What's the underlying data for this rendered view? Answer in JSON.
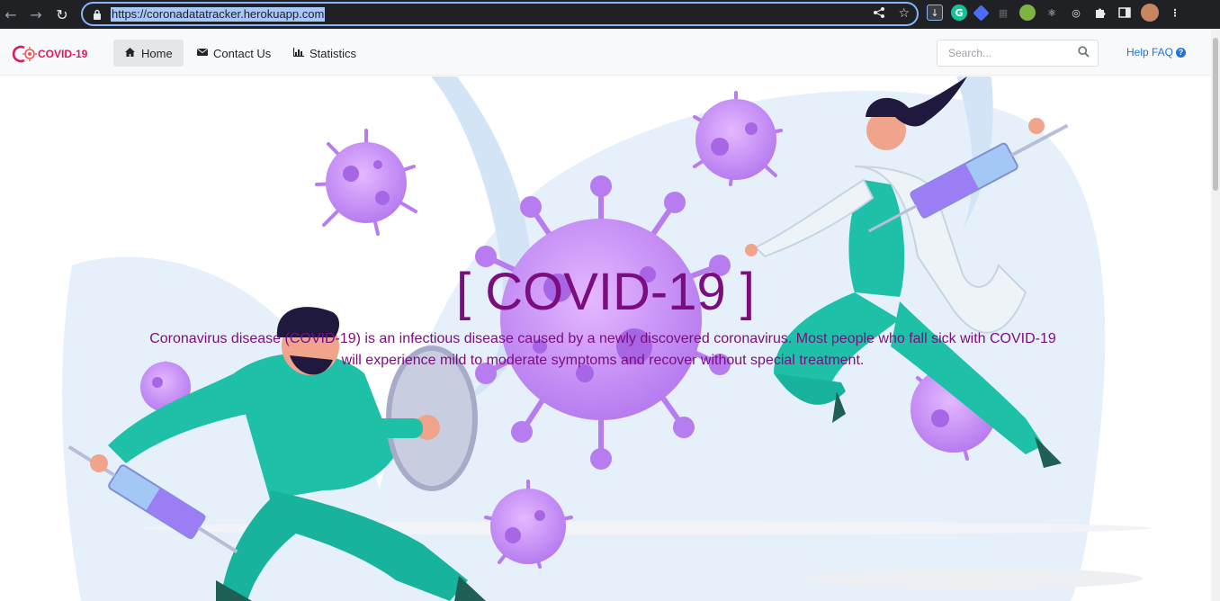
{
  "browser": {
    "url": "https://coronadatatracker.herokuapp.com",
    "icons": [
      "back-arrow-icon",
      "forward-arrow-icon",
      "reload-icon",
      "lock-icon",
      "share-icon",
      "star-icon"
    ],
    "extensions": [
      "download-icon",
      "grammarly-icon",
      "extension-icon",
      "grid-icon",
      "frog-icon",
      "react-icon",
      "target-icon",
      "puzzle-icon",
      "sidepanel-icon",
      "profile-avatar",
      "menu-icon"
    ]
  },
  "navbar": {
    "brand": "COVID-19",
    "items": [
      {
        "label": "Home",
        "icon": "home-icon",
        "active": true
      },
      {
        "label": "Contact Us",
        "icon": "envelope-icon",
        "active": false
      },
      {
        "label": "Statistics",
        "icon": "chart-icon",
        "active": false
      }
    ],
    "search_placeholder": "Search...",
    "help_label": "Help FAQ"
  },
  "hero": {
    "title": "[ COVID-19 ]",
    "description": "Coronavirus disease (COVID-19) is an infectious disease caused by a newly discovered coronavirus. Most people who fall sick with COVID-19 will experience mild to moderate symptoms and recover without special treatment."
  },
  "colors": {
    "chrome_bg": "#202124",
    "url_highlight": "#a8c7fa",
    "navbar_bg": "#f8f9fa",
    "accent_purple": "#7b0e7e",
    "virus_purple": "#c084f5",
    "scrub_teal": "#1fc0a8",
    "link_blue": "#1a73e8"
  }
}
